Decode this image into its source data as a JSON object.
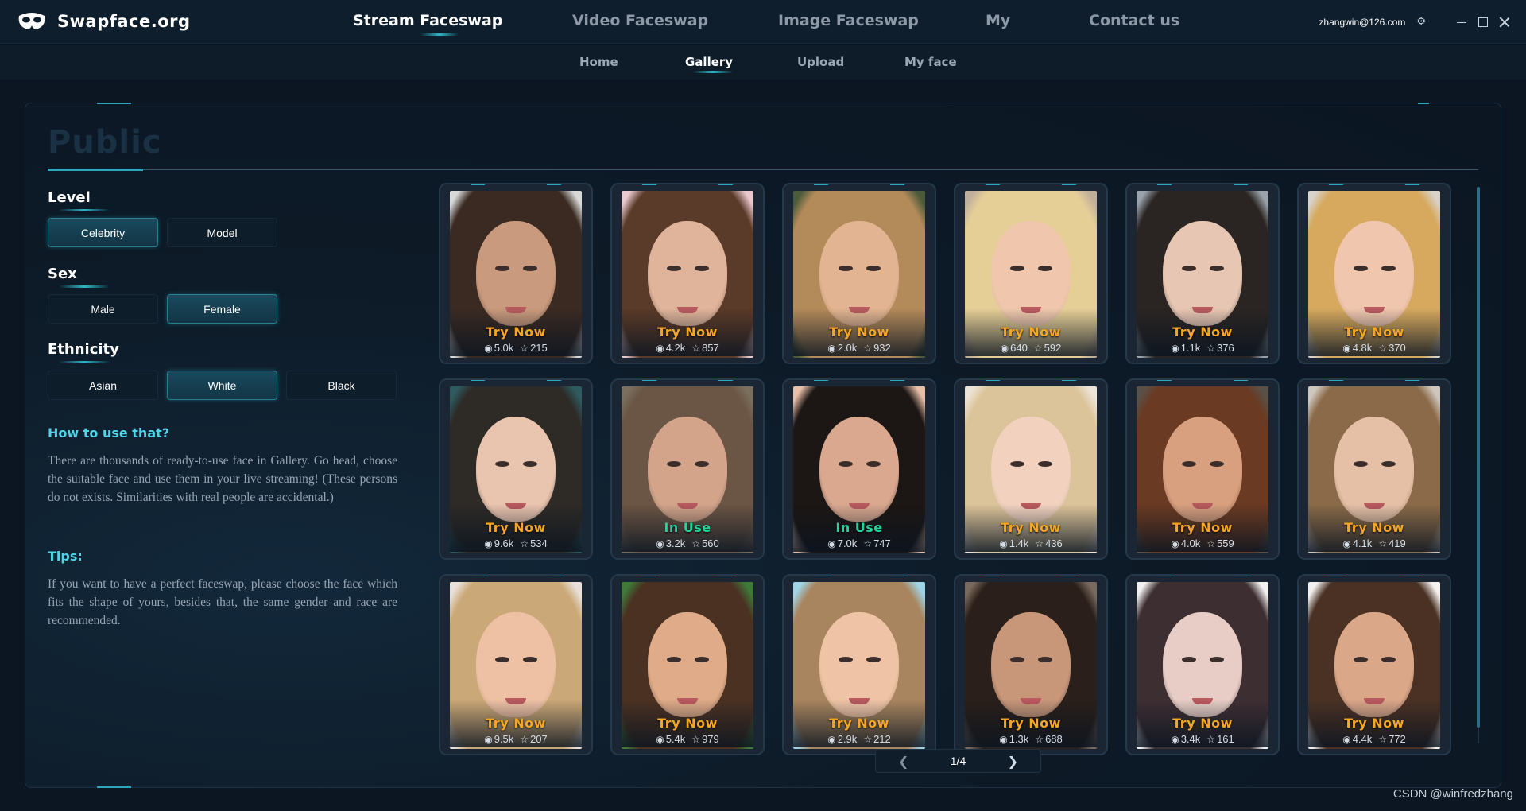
{
  "app": {
    "name": "Swapface.org",
    "logo_icon": "mask-icon"
  },
  "main_nav": [
    {
      "label": "Stream Faceswap",
      "active": true
    },
    {
      "label": "Video Faceswap",
      "active": false
    },
    {
      "label": "Image Faceswap",
      "active": false
    },
    {
      "label": "My",
      "active": false
    },
    {
      "label": "Contact us",
      "active": false
    }
  ],
  "user": {
    "email": "zhangwin@126.com",
    "settings_icon": "gear-icon"
  },
  "window_controls": [
    "minimize-icon",
    "maximize-icon",
    "close-icon"
  ],
  "sub_nav": [
    {
      "label": "Home",
      "active": false
    },
    {
      "label": "Gallery",
      "active": true
    },
    {
      "label": "Upload",
      "active": false
    },
    {
      "label": "My face",
      "active": false
    }
  ],
  "panel": {
    "title": "Public"
  },
  "filters": {
    "level": {
      "label": "Level",
      "options": [
        {
          "label": "Celebrity",
          "selected": true
        },
        {
          "label": "Model",
          "selected": false
        }
      ]
    },
    "sex": {
      "label": "Sex",
      "options": [
        {
          "label": "Male",
          "selected": false
        },
        {
          "label": "Female",
          "selected": true
        }
      ]
    },
    "ethnicity": {
      "label": "Ethnicity",
      "options": [
        {
          "label": "Asian",
          "selected": false
        },
        {
          "label": "White",
          "selected": true
        },
        {
          "label": "Black",
          "selected": false
        }
      ]
    }
  },
  "help": {
    "title": "How to use that?",
    "text": "There are thousands of ready-to-use face in Gallery. Go head, choose the suitable face and use them in your live streaming! (These persons do not exists. Similarities with real people are accidental.)",
    "tips_title": "Tips:",
    "tips_text": "If you want to have a perfect faceswap, please choose the face which fits the shape of yours, besides that, the same gender and race are recommended."
  },
  "gallery": {
    "view_icon": "eye-icon",
    "like_icon": "star-icon",
    "cards": [
      {
        "action": "Try Now",
        "views": "5.0k",
        "likes": "215",
        "hair": "#3a2a22",
        "skin": "#c99a7d",
        "bg": "#d9d9d9"
      },
      {
        "action": "Try Now",
        "views": "4.2k",
        "likes": "857",
        "hair": "#5a3a28",
        "skin": "#e0b49a",
        "bg": "#e8c9cf"
      },
      {
        "action": "Try Now",
        "views": "2.0k",
        "likes": "932",
        "hair": "#b38a5a",
        "skin": "#e2b491",
        "bg": "#4a5a3a"
      },
      {
        "action": "Try Now",
        "views": "640",
        "likes": "592",
        "hair": "#e6cf97",
        "skin": "#f0c7ad",
        "bg": "#bfae9a"
      },
      {
        "action": "Try Now",
        "views": "1.1k",
        "likes": "376",
        "hair": "#2a2522",
        "skin": "#e7c6b3",
        "bg": "#9aa3ab"
      },
      {
        "action": "Try Now",
        "views": "4.8k",
        "likes": "370",
        "hair": "#d6a95e",
        "skin": "#f0c6ae",
        "bg": "#d8d2c8"
      },
      {
        "action": "Try Now",
        "views": "9.6k",
        "likes": "534",
        "hair": "#2e2a26",
        "skin": "#e9c4ae",
        "bg": "#2f5a5f"
      },
      {
        "action": "In Use",
        "views": "3.2k",
        "likes": "560",
        "hair": "#6b5544",
        "skin": "#d3a48a",
        "bg": "#7a6f5f"
      },
      {
        "action": "In Use",
        "views": "7.0k",
        "likes": "747",
        "hair": "#1c1614",
        "skin": "#d9a88f",
        "bg": "#e8bfa8"
      },
      {
        "action": "Try Now",
        "views": "1.4k",
        "likes": "436",
        "hair": "#dcc49a",
        "skin": "#f2d2bf",
        "bg": "#ede3d6"
      },
      {
        "action": "Try Now",
        "views": "4.0k",
        "likes": "559",
        "hair": "#6a3a22",
        "skin": "#d9a07f",
        "bg": "#5a5048"
      },
      {
        "action": "Try Now",
        "views": "4.1k",
        "likes": "419",
        "hair": "#8a6a48",
        "skin": "#e6c0a6",
        "bg": "#cfc7bd"
      },
      {
        "action": "Try Now",
        "views": "9.5k",
        "likes": "207",
        "hair": "#cba877",
        "skin": "#eec1a4",
        "bg": "#e9e0d9"
      },
      {
        "action": "Try Now",
        "views": "5.4k",
        "likes": "979",
        "hair": "#4a3122",
        "skin": "#e0ab88",
        "bg": "#3f7a3a"
      },
      {
        "action": "Try Now",
        "views": "2.9k",
        "likes": "212",
        "hair": "#a8855e",
        "skin": "#efc4a6",
        "bg": "#9fd3e6"
      },
      {
        "action": "Try Now",
        "views": "1.3k",
        "likes": "688",
        "hair": "#2a1f1a",
        "skin": "#c8977a",
        "bg": "#7a6a5e"
      },
      {
        "action": "Try Now",
        "views": "3.4k",
        "likes": "161",
        "hair": "#3d2e32",
        "skin": "#e7cdc5",
        "bg": "#f2f0f0"
      },
      {
        "action": "Try Now",
        "views": "4.4k",
        "likes": "772",
        "hair": "#4a3124",
        "skin": "#dba789",
        "bg": "#f3f0ee"
      }
    ]
  },
  "pagination": {
    "prev_icon": "chevron-left-icon",
    "next_icon": "chevron-right-icon",
    "page": "1/4"
  },
  "watermark": "CSDN @winfredzhang",
  "colors": {
    "accent": "#2fb6c8",
    "try_now": "#f5a623",
    "in_use": "#22d39a"
  }
}
